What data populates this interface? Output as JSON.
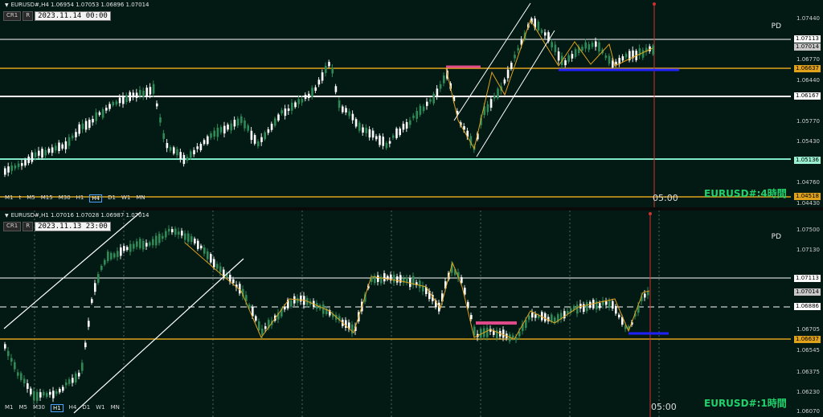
{
  "top_chart": {
    "title": "EURUSD#,H4  1.06954 1.07053 1.06896 1.07014",
    "tb1": "CR1",
    "tb2": "R",
    "datetime": "2023.11.14 00:00",
    "pd": "PD",
    "watermark": "EURUSD#:4時間",
    "time_label": "05:00",
    "timeframes": [
      "M1",
      "t",
      "M5",
      "M15",
      "M30",
      "H1",
      "H4",
      "D1",
      "W1",
      "MN"
    ],
    "selected_timeframe": "H4",
    "axis_labels": [
      "1.07440",
      "1.06770",
      "1.06440",
      "1.05770",
      "1.05430",
      "1.04760",
      "1.04430"
    ],
    "price_boxes": [
      {
        "text": "1.07113",
        "bg": "#ffffff",
        "fg": "#000000"
      },
      {
        "text": "1.07014",
        "bg": "#c8c8c8",
        "fg": "#000000"
      },
      {
        "text": "1.06637",
        "bg": "#e0a11b",
        "fg": "#000000"
      },
      {
        "text": "1.06167",
        "bg": "#ffffff",
        "fg": "#000000"
      },
      {
        "text": "1.05136",
        "bg": "#9af0d0",
        "fg": "#000000"
      },
      {
        "text": "1.04518",
        "bg": "#e0a11b",
        "fg": "#000000"
      }
    ],
    "colors": {
      "bull": "#2e8b57",
      "bear": "#ffffff",
      "support": "#e0a11b",
      "level": "#ffffff",
      "teal": "#7fe8c8"
    }
  },
  "bottom_chart": {
    "title": "EURUSD#,H1  1.07016 1.07028 1.06987 1.07014",
    "tb1": "CR1",
    "tb2": "R",
    "datetime": "2023.11.13 23:00",
    "pd": "PD",
    "watermark": "EURUSD#:1時間",
    "time_label": "05:00",
    "timeframes": [
      "M1",
      "M5",
      "M30",
      "H1",
      "H4",
      "D1",
      "W1",
      "MN"
    ],
    "selected_timeframe": "H1",
    "axis_labels": [
      "1.07500",
      "1.07130",
      "1.06705",
      "1.06545",
      "1.06375",
      "1.06230",
      "1.06070"
    ],
    "price_boxes": [
      {
        "text": "1.07113",
        "bg": "#ffffff",
        "fg": "#000000"
      },
      {
        "text": "1.07014",
        "bg": "#c8c8c8",
        "fg": "#000000"
      },
      {
        "text": "1.06886",
        "bg": "#ffffff",
        "fg": "#000000"
      },
      {
        "text": "1.06637",
        "bg": "#e0a11b",
        "fg": "#000000"
      }
    ]
  }
}
